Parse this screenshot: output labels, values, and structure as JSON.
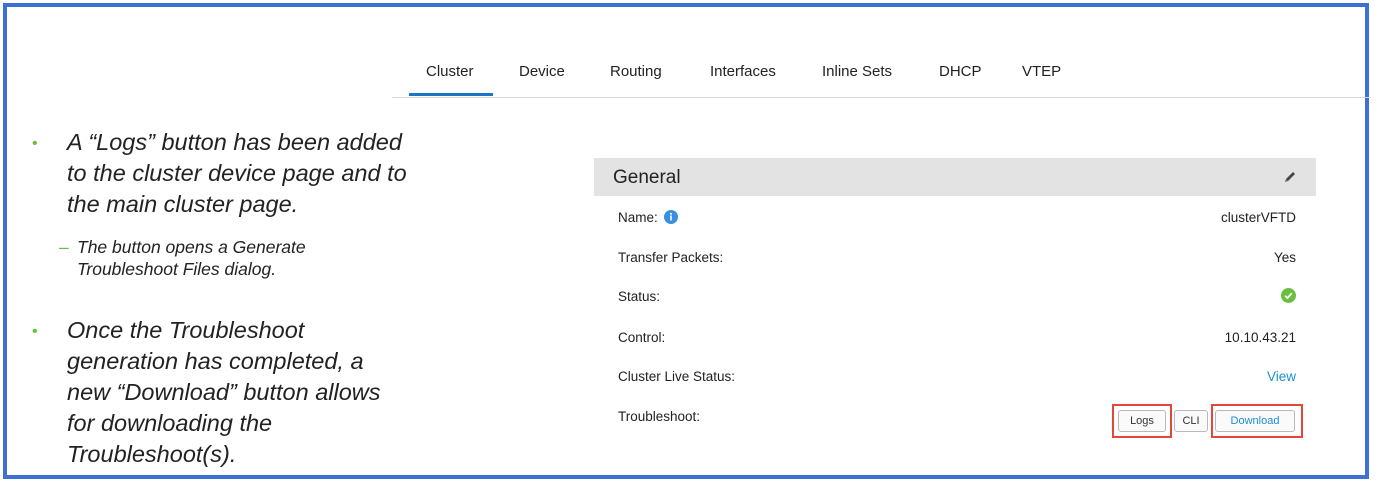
{
  "tabs": {
    "items": [
      {
        "label": "Cluster"
      },
      {
        "label": "Device"
      },
      {
        "label": "Routing"
      },
      {
        "label": "Interfaces"
      },
      {
        "label": "Inline Sets"
      },
      {
        "label": "DHCP"
      },
      {
        "label": "VTEP"
      }
    ],
    "active": "Cluster"
  },
  "bullets": {
    "b1_lines": [
      "A “Logs” button has been added",
      "to the cluster device page and to",
      "the main cluster page."
    ],
    "sub_lines": [
      "The button opens a Generate",
      "Troubleshoot Files dialog."
    ],
    "b2_lines": [
      "Once the Troubleshoot",
      "generation has completed, a",
      "new “Download” button allows",
      "for downloading the",
      "Troubleshoot(s)."
    ]
  },
  "general": {
    "title": "General",
    "rows": [
      {
        "label": "Name:",
        "value": "clusterVFTD"
      },
      {
        "label": "Transfer Packets:",
        "value": "Yes"
      },
      {
        "label": "Status:",
        "value": ""
      },
      {
        "label": "Control:",
        "value": "10.10.43.21"
      },
      {
        "label": "Cluster Live Status:",
        "value": "View"
      },
      {
        "label": "Troubleshoot:",
        "value": ""
      }
    ],
    "buttons": {
      "logs": "Logs",
      "cli": "CLI",
      "download": "Download"
    }
  },
  "colors": {
    "frame_border": "#3d6fd6",
    "tab_active": "#1a75c7",
    "bullet": "#6bbf3f",
    "link": "#1a8fd6",
    "status_ok": "#6bbf3f",
    "highlight": "#e2473a"
  },
  "icons": {
    "edit": "pencil-icon",
    "info": "info-icon",
    "status": "check-circle-icon"
  }
}
